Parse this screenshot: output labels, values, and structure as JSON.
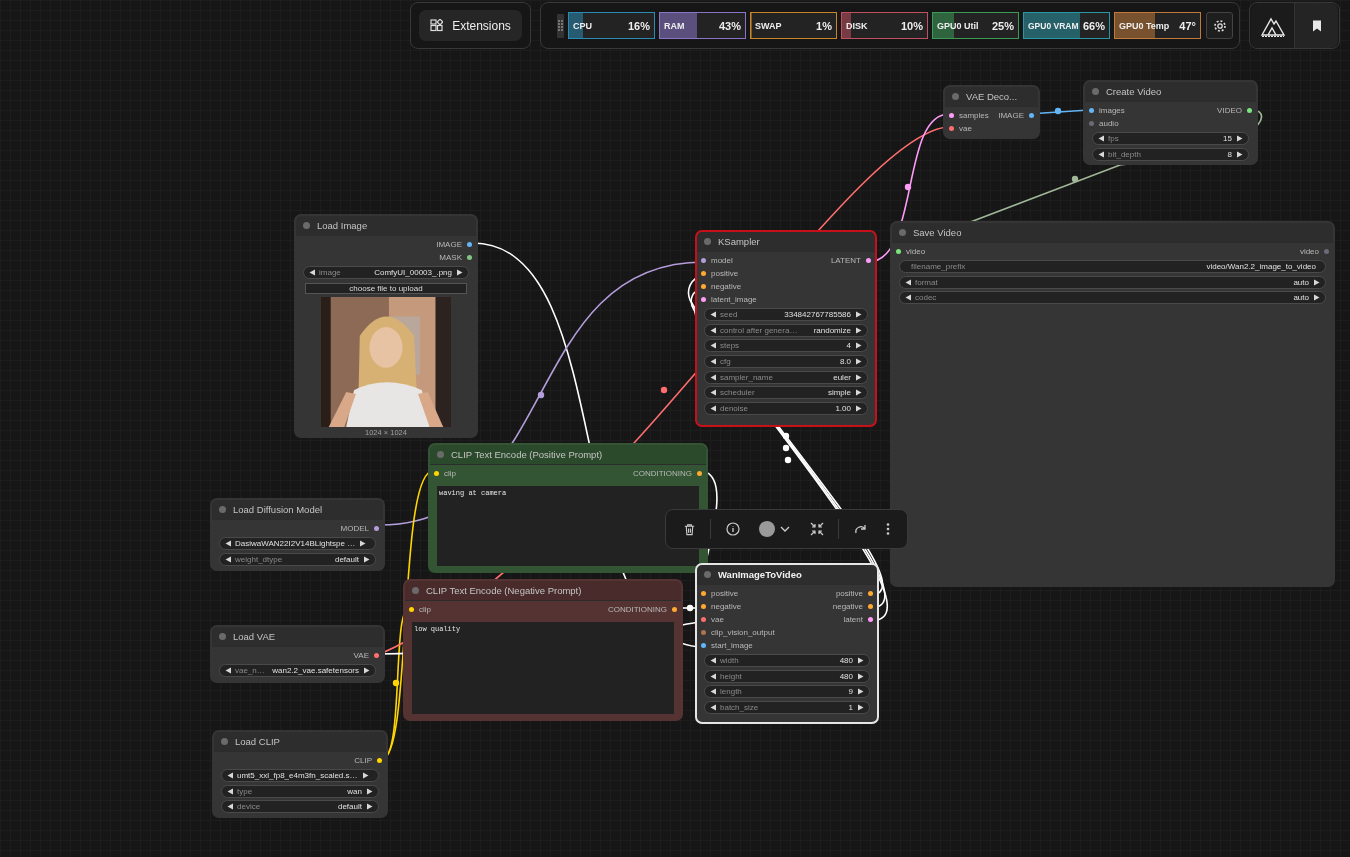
{
  "top_bar": {
    "extensions_button": "Extensions",
    "monitors": [
      {
        "label": "CPU",
        "value": "16%",
        "level": 0.16,
        "color": "#2b8bb5"
      },
      {
        "label": "RAM",
        "value": "43%",
        "level": 0.43,
        "color": "#8a74c8"
      },
      {
        "label": "SWAP",
        "value": "1%",
        "level": 0.01,
        "color": "#c8862a"
      },
      {
        "label": "DISK",
        "value": "10%",
        "level": 0.1,
        "color": "#c05060"
      },
      {
        "label": "GPU0 Util",
        "value": "25%",
        "level": 0.25,
        "color": "#3a9a56"
      },
      {
        "label": "GPU0 VRAM",
        "value": "66%",
        "level": 0.66,
        "color": "#2a96a6"
      },
      {
        "label": "GPU0 Temp",
        "value": "47°",
        "level": 0.47,
        "color": "#c07a3a"
      }
    ]
  },
  "nodes": [
    {
      "title": "VAE Deco...",
      "selected": false,
      "error": false,
      "color": "#353535",
      "inputs": [
        {
          "label": "samples",
          "color": "#ff9cf9"
        },
        {
          "label": "vae",
          "color": "#ff6e6e"
        }
      ],
      "outputs": [
        {
          "label": "IMAGE",
          "color": "#64b5f6"
        }
      ]
    },
    {
      "title": "Create Video",
      "selected": false,
      "error": false,
      "color": "#353535",
      "inputs": [
        {
          "label": "images",
          "color": "#64b5f6"
        },
        {
          "label": "audio",
          "color": "#6a6a78"
        }
      ],
      "outputs": [
        {
          "label": "VIDEO",
          "color": "#7be57b"
        }
      ],
      "widgets": [
        {
          "kind": "stepper",
          "label": "fps",
          "value": "15"
        },
        {
          "kind": "stepper",
          "label": "bit_depth",
          "value": "8"
        }
      ]
    },
    {
      "title": "Load Image",
      "selected": false,
      "error": false,
      "color": "#353535",
      "outputs": [
        {
          "label": "IMAGE",
          "color": "#64b5f6"
        },
        {
          "label": "MASK",
          "color": "#81c784"
        }
      ],
      "widgets": [
        {
          "kind": "stepper",
          "label": "image",
          "value": "ComfyUI_00003_.png"
        }
      ],
      "upload_button": "choose file to upload",
      "image": {
        "kind": "picture",
        "caption": "1024 × 1024"
      }
    },
    {
      "title": "KSampler",
      "selected": false,
      "error": true,
      "color": "#353535",
      "inputs": [
        {
          "label": "model",
          "color": "#b39ddb"
        },
        {
          "label": "positive",
          "color": "#ffa931"
        },
        {
          "label": "negative",
          "color": "#ffa931"
        },
        {
          "label": "latent_image",
          "color": "#ff9cf9"
        }
      ],
      "outputs": [
        {
          "label": "LATENT",
          "color": "#ff9cf9"
        }
      ],
      "widgets": [
        {
          "kind": "stepper",
          "label": "seed",
          "value": "334842767785586"
        },
        {
          "kind": "stepper",
          "label": "control after genera…",
          "value": "randomize"
        },
        {
          "kind": "stepper",
          "label": "steps",
          "value": "4"
        },
        {
          "kind": "stepper",
          "label": "cfg",
          "value": "8.0"
        },
        {
          "kind": "stepper",
          "label": "sampler_name",
          "value": "euler"
        },
        {
          "kind": "stepper",
          "label": "scheduler",
          "value": "simple"
        },
        {
          "kind": "stepper",
          "label": "denoise",
          "value": "1.00"
        }
      ]
    },
    {
      "title": "Save Video",
      "selected": false,
      "error": false,
      "color": "#353535",
      "inputs": [
        {
          "label": "video",
          "color": "#7be57b"
        }
      ],
      "outputs": [
        {
          "label": "video",
          "color": "#6a6a78"
        }
      ],
      "widgets": [
        {
          "kind": "text",
          "label": "filename_prefix",
          "value": "video/Wan2.2_image_to_video"
        },
        {
          "kind": "stepper",
          "label": "format",
          "value": "auto"
        },
        {
          "kind": "stepper",
          "label": "codec",
          "value": "auto"
        }
      ]
    },
    {
      "title": "CLIP Text Encode (Positive Prompt)",
      "selected": false,
      "error": false,
      "color": "#335533",
      "inputs": [
        {
          "label": "clip",
          "color": "#ffd500"
        }
      ],
      "outputs": [
        {
          "label": "CONDITIONING",
          "color": "#ffa931"
        }
      ],
      "prompt": "waving at camera"
    },
    {
      "title": "Load Diffusion Model",
      "selected": false,
      "error": false,
      "color": "#353535",
      "outputs": [
        {
          "label": "MODEL",
          "color": "#b39ddb"
        }
      ],
      "widgets": [
        {
          "kind": "stepper",
          "value": "DasiwaWAN22I2V14BLightspe …"
        },
        {
          "kind": "stepper",
          "label": "weight_dtype",
          "value": "default"
        }
      ]
    },
    {
      "title": "CLIP Text Encode (Negative Prompt)",
      "selected": false,
      "error": false,
      "color": "#553333",
      "inputs": [
        {
          "label": "clip",
          "color": "#ffd500"
        }
      ],
      "outputs": [
        {
          "label": "CONDITIONING",
          "color": "#ffa931"
        }
      ],
      "prompt": "low quality"
    },
    {
      "title": "Load VAE",
      "selected": false,
      "error": false,
      "color": "#353535",
      "outputs": [
        {
          "label": "VAE",
          "color": "#ff6e6e"
        }
      ],
      "widgets": [
        {
          "kind": "stepper",
          "label": "vae_n…",
          "value": "wan2.2_vae.safetensors"
        }
      ]
    },
    {
      "title": "WanImageToVideo",
      "selected": true,
      "error": false,
      "color": "#353535",
      "inputs": [
        {
          "label": "positive",
          "color": "#ffa931"
        },
        {
          "label": "negative",
          "color": "#ffa931"
        },
        {
          "label": "vae",
          "color": "#ff6e6e"
        },
        {
          "label": "clip_vision_output",
          "color": "#ad7452"
        },
        {
          "label": "start_image",
          "color": "#64b5f6"
        }
      ],
      "outputs": [
        {
          "label": "positive",
          "color": "#ffa931"
        },
        {
          "label": "negative",
          "color": "#ffa931"
        },
        {
          "label": "latent",
          "color": "#ff9cf9"
        }
      ],
      "widgets": [
        {
          "kind": "stepper",
          "label": "width",
          "value": "480"
        },
        {
          "kind": "stepper",
          "label": "height",
          "value": "480"
        },
        {
          "kind": "stepper",
          "label": "length",
          "value": "9"
        },
        {
          "kind": "stepper",
          "label": "batch_size",
          "value": "1"
        }
      ]
    },
    {
      "title": "Load CLIP",
      "selected": false,
      "error": false,
      "color": "#353535",
      "outputs": [
        {
          "label": "CLIP",
          "color": "#ffd500"
        }
      ],
      "widgets": [
        {
          "kind": "stepper",
          "value": "umt5_xxl_fp8_e4m3fn_scaled.s…"
        },
        {
          "kind": "stepper",
          "label": "type",
          "value": "wan"
        },
        {
          "kind": "stepper",
          "label": "device",
          "value": "default"
        }
      ]
    }
  ]
}
